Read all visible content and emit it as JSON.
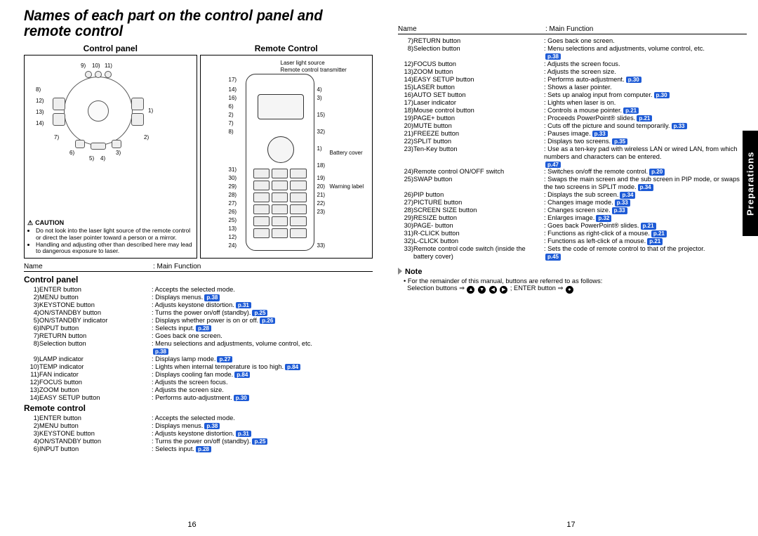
{
  "title": "Names of each part on the control panel and remote control",
  "sideTab": "Preparations",
  "pageNumbers": {
    "left": "16",
    "right": "17"
  },
  "headings": {
    "cp": "Control panel",
    "rc": "Remote Control",
    "rcLower": "Remote control"
  },
  "nameLabel": "Name",
  "mainFnLabel": ": Main Function",
  "callouts": {
    "laserLight": "Laser light source",
    "rcTransmitter": "Remote control transmitter",
    "battery": "Battery cover",
    "warning": "Warning label"
  },
  "caution": {
    "title": "CAUTION",
    "items": [
      "Do not look into the laser light source of the remote control or direct the laser pointer toward a person or a mirror.",
      "Handling and adjusting other than described here may lead to dangerous exposure to laser."
    ]
  },
  "controlPanel": [
    {
      "n": "1)",
      "name": "ENTER button",
      "fn": ": Accepts the selected mode."
    },
    {
      "n": "2)",
      "name": "MENU button",
      "fn": ": Displays menus.",
      "p": "p.38"
    },
    {
      "n": "3)",
      "name": "KEYSTONE button",
      "fn": ": Adjusts keystone distortion.",
      "p": "p.31"
    },
    {
      "n": "4)",
      "name": "ON/STANDBY button",
      "fn": ": Turns the power on/off (standby).",
      "p": "p.25"
    },
    {
      "n": "5)",
      "name": "ON/STANDBY indicator",
      "fn": ": Displays whether power is on or off.",
      "p": "p.26"
    },
    {
      "n": "6)",
      "name": "INPUT button",
      "fn": ": Selects input.",
      "p": "p.28"
    },
    {
      "n": "7)",
      "name": "RETURN button",
      "fn": ": Goes back one screen."
    },
    {
      "n": "8)",
      "name": "Selection button",
      "fn": ": Menu selections and adjustments, volume control, etc.",
      "p": "p.38",
      "pBelow": true
    },
    {
      "n": "9)",
      "name": "LAMP indicator",
      "fn": ": Displays lamp mode.",
      "p": "p.27"
    },
    {
      "n": "10)",
      "name": "TEMP indicator",
      "fn": ": Lights when internal temperature is too high.",
      "p": "p.84"
    },
    {
      "n": "11)",
      "name": "FAN indicator",
      "fn": ": Displays cooling fan mode.",
      "p": "p.84"
    },
    {
      "n": "12)",
      "name": "FOCUS button",
      "fn": ": Adjusts the screen focus."
    },
    {
      "n": "13)",
      "name": "ZOOM button",
      "fn": ": Adjusts the screen size."
    },
    {
      "n": "14)",
      "name": "EASY SETUP button",
      "fn": ": Performs auto-adjustment.",
      "p": "p.30"
    }
  ],
  "remoteControl": [
    {
      "n": "1)",
      "name": "ENTER button",
      "fn": ": Accepts the selected mode."
    },
    {
      "n": "2)",
      "name": "MENU button",
      "fn": ": Displays menus.",
      "p": "p.38"
    },
    {
      "n": "3)",
      "name": "KEYSTONE button",
      "fn": ": Adjusts keystone distortion.",
      "p": "p.31"
    },
    {
      "n": "4)",
      "name": "ON/STANDBY button",
      "fn": ": Turns the power on/off (standby).",
      "p": "p.25"
    },
    {
      "n": "6)",
      "name": "INPUT button",
      "fn": ": Selects input.",
      "p": "p.28"
    }
  ],
  "rightList": [
    {
      "n": "7)",
      "name": "RETURN button",
      "fn": ": Goes back one screen."
    },
    {
      "n": "8)",
      "name": "Selection button",
      "fn": ": Menu selections and adjustments, volume control, etc.",
      "p": "p.38",
      "pBelow": true
    },
    {
      "n": "12)",
      "name": "FOCUS button",
      "fn": ": Adjusts the screen focus."
    },
    {
      "n": "13)",
      "name": "ZOOM button",
      "fn": ": Adjusts the screen size."
    },
    {
      "n": "14)",
      "name": "EASY SETUP button",
      "fn": ": Performs auto-adjustment.",
      "p": "p.30"
    },
    {
      "n": "15)",
      "name": "LASER button",
      "fn": ": Shows a laser pointer."
    },
    {
      "n": "16)",
      "name": "AUTO SET button",
      "fn": ": Sets up analog input from computer.",
      "p": "p.30"
    },
    {
      "n": "17)",
      "name": "Laser indicator",
      "fn": ": Lights when laser is on."
    },
    {
      "n": "18)",
      "name": "Mouse control button",
      "fn": ": Controls a mouse pointer.",
      "p": "p.21"
    },
    {
      "n": "19)",
      "name": "PAGE+ button",
      "fn": ": Proceeds PowerPoint® slides.",
      "p": "p.21"
    },
    {
      "n": "20)",
      "name": "MUTE button",
      "fn": ": Cuts off the picture and sound temporarily.",
      "p": "p.33"
    },
    {
      "n": "21)",
      "name": "FREEZE button",
      "fn": ": Pauses image.",
      "p": "p.33"
    },
    {
      "n": "22)",
      "name": "SPLIT button",
      "fn": ": Displays two screens.",
      "p": "p.35"
    },
    {
      "n": "23)",
      "name": "Ten-Key button",
      "fn": ": Use as a ten-key pad with wireless LAN or wired LAN, from which numbers and characters can be entered.",
      "p": "p.47",
      "pBelow": true
    },
    {
      "n": "24)",
      "name": "Remote control ON/OFF switch",
      "fn": ": Switches on/off the remote control.",
      "p": "p.20"
    },
    {
      "n": "25)",
      "name": "SWAP button",
      "fn": ": Swaps the main screen and the sub screen in PIP mode, or swaps the two screens in SPLIT mode.",
      "p": "p.34"
    },
    {
      "n": "26)",
      "name": "PIP button",
      "fn": ": Displays the sub screen.",
      "p": "p.34"
    },
    {
      "n": "27)",
      "name": "PICTURE button",
      "fn": ": Changes image mode.",
      "p": "p.33"
    },
    {
      "n": "28)",
      "name": "SCREEN SIZE button",
      "fn": ": Changes screen size.",
      "p": "p.33"
    },
    {
      "n": "29)",
      "name": "RESIZE button",
      "fn": ": Enlarges image.",
      "p": "p.32"
    },
    {
      "n": "30)",
      "name": "PAGE- button",
      "fn": ": Goes back PowerPoint® slides.",
      "p": "p.21"
    },
    {
      "n": "31)",
      "name": "R-CLICK button",
      "fn": ": Functions as right-click of a mouse.",
      "p": "p.21"
    },
    {
      "n": "32)",
      "name": "L-CLICK button",
      "fn": ": Functions as left-click of a mouse.",
      "p": "p.21"
    },
    {
      "n": "33)",
      "name": "Remote control code switch (inside the battery cover)",
      "fn": ": Sets the code of remote control to that of the projector.",
      "p": "p.45",
      "pBelow": true
    }
  ],
  "note": {
    "title": "Note",
    "line1": "For the remainder of this manual, buttons are referred to as follows:",
    "line2a": "Selection buttons ⇒ ",
    "line2b": " ; ENTER button ⇒ "
  }
}
